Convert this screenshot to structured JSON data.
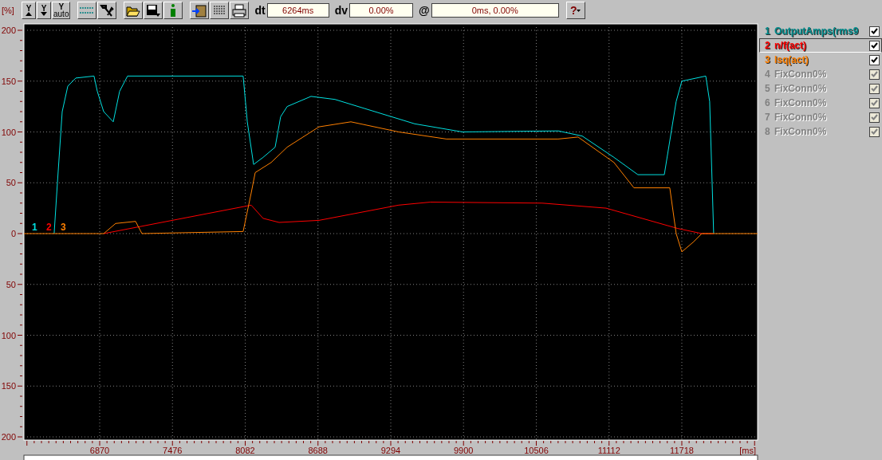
{
  "toolbar": {
    "unit": "[%]",
    "buttons": [
      {
        "kind": "up",
        "label": "Y"
      },
      {
        "kind": "down",
        "label": "Y"
      },
      {
        "kind": "auto",
        "label": "Y",
        "sub": "auto"
      },
      {
        "kind": "icon"
      },
      {
        "kind": "icon"
      },
      {
        "kind": "icon"
      },
      {
        "kind": "icon"
      },
      {
        "kind": "icon"
      },
      {
        "kind": "icon"
      },
      {
        "kind": "icon"
      },
      {
        "kind": "icon"
      }
    ],
    "fields": [
      {
        "label": "dt",
        "value": "6264ms"
      },
      {
        "label": "dv",
        "value": "0.00%"
      },
      {
        "label": "@",
        "value": "0ms, 0.00%"
      }
    ],
    "help": "?"
  },
  "chart": {
    "trace_markers": [
      {
        "label": "1",
        "color": "#00e0e0"
      },
      {
        "label": "2",
        "color": "#ff0000"
      },
      {
        "label": "3",
        "color": "#ff8000"
      }
    ],
    "x_unit": "[ms]",
    "chart_data": {
      "type": "line",
      "grid": true,
      "xlim": [
        6239,
        12349
      ],
      "ylim": [
        -200,
        200
      ],
      "xticks": [
        6870,
        7476,
        8082,
        8688,
        9294,
        9900,
        10506,
        11112,
        11718
      ],
      "yticks": [
        {
          "value": 200,
          "label": "200"
        },
        {
          "value": 150,
          "label": "150"
        },
        {
          "value": 100,
          "label": "100"
        },
        {
          "value": 50,
          "label": "50"
        },
        {
          "value": 0,
          "label": "0"
        },
        {
          "value": -50,
          "label": "50"
        },
        {
          "value": -100,
          "label": "100"
        },
        {
          "value": -150,
          "label": "150"
        },
        {
          "value": -200,
          "label": "200"
        }
      ],
      "series": [
        {
          "color": "#00e0e0",
          "x": [
            6491,
            6518,
            6558,
            6604,
            6671,
            6823,
            6850,
            6903,
            6983,
            7036,
            7102,
            8065,
            8099,
            8152,
            8231,
            8331,
            8377,
            8431,
            8630,
            8829,
            9161,
            9493,
            9892,
            10688,
            10888,
            11153,
            11352,
            11572,
            11671,
            11718,
            11917,
            11950,
            11983
          ],
          "values": [
            0,
            50,
            120,
            145,
            153,
            155,
            140,
            120,
            110,
            140,
            155,
            155,
            110,
            68,
            75,
            85,
            115,
            125,
            135,
            132,
            120,
            108,
            100,
            101,
            96,
            75,
            58,
            58,
            130,
            150,
            155,
            130,
            0
          ]
        },
        {
          "color": "#ff0000",
          "x": [
            6903,
            8132,
            8231,
            8364,
            8696,
            9360,
            9625,
            10555,
            11087,
            11684,
            11884,
            11983
          ],
          "values": [
            0,
            28,
            15,
            11,
            13,
            28,
            31,
            30,
            25,
            5,
            0,
            0
          ]
        },
        {
          "color": "#ff8000",
          "x": [
            6239,
            6903,
            7003,
            7169,
            7222,
            8065,
            8132,
            8165,
            8298,
            8431,
            8696,
            8962,
            9360,
            9758,
            10688,
            10854,
            11153,
            11319,
            11618,
            11671,
            11718,
            11817,
            11884,
            11983,
            12349
          ],
          "values": [
            0,
            0,
            10,
            12,
            0,
            2,
            40,
            60,
            70,
            85,
            105,
            110,
            100,
            93,
            93,
            95,
            70,
            45,
            45,
            0,
            -18,
            -8,
            0,
            0,
            0
          ]
        }
      ]
    }
  },
  "legend": [
    {
      "number": "1",
      "name": "OutputAmps(rms9",
      "color": "#008c8c",
      "checked": true,
      "disabled": false,
      "selected": false
    },
    {
      "number": "2",
      "name": "n/f(act)",
      "color": "#ff0000",
      "checked": true,
      "disabled": false,
      "selected": true
    },
    {
      "number": "3",
      "name": "Isq(act)",
      "color": "#ff8000",
      "checked": true,
      "disabled": false,
      "selected": false
    },
    {
      "number": "4",
      "name": "FixConn0%",
      "color": "#808080",
      "checked": true,
      "disabled": true,
      "selected": false
    },
    {
      "number": "5",
      "name": "FixConn0%",
      "color": "#808080",
      "checked": true,
      "disabled": true,
      "selected": false
    },
    {
      "number": "6",
      "name": "FixConn0%",
      "color": "#808080",
      "checked": true,
      "disabled": true,
      "selected": false
    },
    {
      "number": "7",
      "name": "FixConn0%",
      "color": "#808080",
      "checked": true,
      "disabled": true,
      "selected": false
    },
    {
      "number": "8",
      "name": "FixConn0%",
      "color": "#808080",
      "checked": true,
      "disabled": true,
      "selected": false
    }
  ]
}
